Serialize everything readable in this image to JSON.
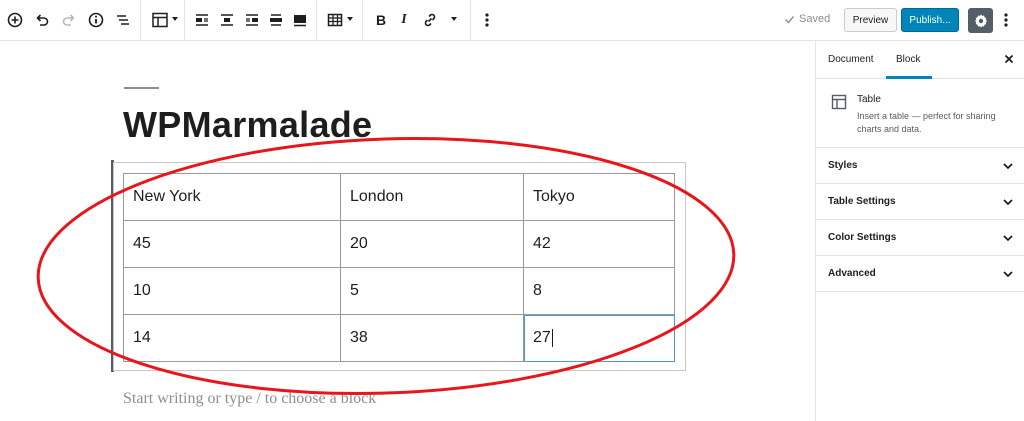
{
  "toolbar": {
    "left_icons": [
      "add-block-icon",
      "undo-icon",
      "redo-icon",
      "info-icon",
      "block-navigation-icon"
    ],
    "table_icons": [
      "table-icon",
      "align-left-icon",
      "align-center-icon",
      "align-right-icon",
      "wide-width-icon",
      "full-width-icon",
      "edit-table-icon"
    ],
    "format_icons": [
      "bold-icon",
      "italic-icon",
      "link-icon",
      "more-rich-text-icon",
      "more-options-icon"
    ],
    "saved_label": "Saved",
    "preview_label": "Preview",
    "publish_label": "Publish...",
    "accent_color": "#0085ba"
  },
  "editor": {
    "post_title": "WPMarmalade",
    "table": {
      "rows": [
        [
          "New York",
          "London",
          "Tokyo"
        ],
        [
          "45",
          "20",
          "42"
        ],
        [
          "10",
          "5",
          "8"
        ],
        [
          "14",
          "38",
          "27"
        ]
      ],
      "active_cell": [
        3,
        2
      ]
    },
    "placeholder": "Start writing or type / to choose a block",
    "annotation_color": "#e8161b"
  },
  "sidebar": {
    "tabs": [
      {
        "label": "Document",
        "active": false
      },
      {
        "label": "Block",
        "active": true
      }
    ],
    "block_card": {
      "title": "Table",
      "description": "Insert a table — perfect for sharing charts and data."
    },
    "panels": [
      {
        "label": "Styles"
      },
      {
        "label": "Table Settings"
      },
      {
        "label": "Color Settings"
      },
      {
        "label": "Advanced"
      }
    ]
  }
}
